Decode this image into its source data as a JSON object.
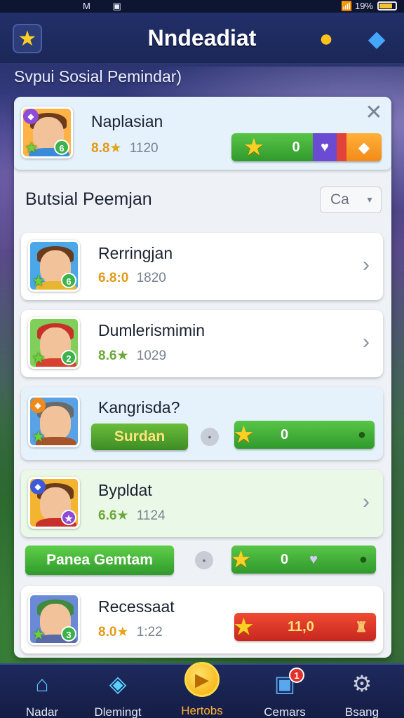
{
  "status": {
    "left": "M ▣",
    "right": "19%"
  },
  "header": {
    "title": "Nndeadiat"
  },
  "subtitle": "Svpui Sosial Pemindar)",
  "top_card": {
    "name": "Naplasian",
    "score": "8.8",
    "count": "1120",
    "bar_value": "0"
  },
  "section": {
    "title": "Butsial Peemjan",
    "sort_label": "Ca"
  },
  "players": [
    {
      "name": "Rerringjan",
      "score": "6.8:0",
      "count": "1820"
    },
    {
      "name": "Dumlerismimin",
      "score": "8.6",
      "count": "1029"
    },
    {
      "name": "Kangrisda?",
      "button": "Surdan",
      "bar_value": "0"
    },
    {
      "name": "Bypldat",
      "score": "6.6",
      "count": "1124"
    },
    {
      "name": "Recessaat",
      "score": "8.0",
      "count": "1:22",
      "bar_value": "11,0"
    }
  ],
  "action": {
    "label": "Panea Gemtam",
    "bar_value": "0"
  },
  "nav": [
    {
      "label": "Nadar"
    },
    {
      "label": "Dlemingt"
    },
    {
      "label": "Hertobs"
    },
    {
      "label": "Cemars",
      "badge": "1"
    },
    {
      "label": "Bsang"
    }
  ],
  "colors": {
    "accent_green": "#3bb34a",
    "accent_orange": "#f28b18",
    "nav_bg": "#1e2a5e"
  }
}
